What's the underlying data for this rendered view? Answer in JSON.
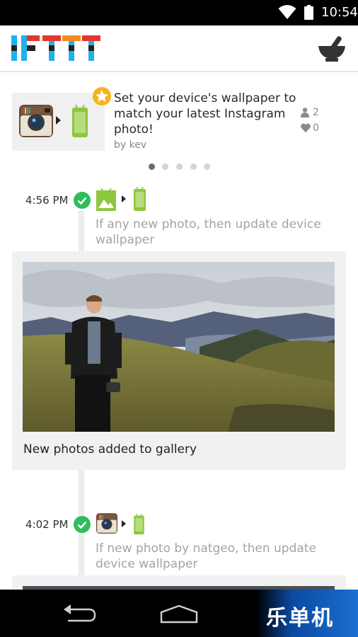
{
  "status_bar": {
    "time": "10:54",
    "icons": [
      "wifi-icon",
      "battery-icon"
    ]
  },
  "app_bar": {
    "logo_text": "IFTTT",
    "logo_colors": [
      "#1eb2e8",
      "#e5352d",
      "#222222",
      "#f58c1f"
    ],
    "right_icon": "mortar-pestle-icon"
  },
  "recipe": {
    "title": "Set your device's wallpaper to match your latest Instagram photo!",
    "author": "by kev",
    "users_count": "2",
    "likes_count": "0",
    "trigger_icon": "instagram-icon",
    "action_icon": "android-device-icon",
    "badge_icon": "star-badge-icon",
    "pager": {
      "total": 5,
      "active": 0
    }
  },
  "feed": [
    {
      "time": "4:56 PM",
      "status_icon": "success-check-icon",
      "trigger_icon": "android-photos-icon",
      "action_icon": "android-device-icon",
      "description": "If any new photo, then update device wallpaper",
      "caption": "New photos added to gallery"
    },
    {
      "time": "4:02 PM",
      "status_icon": "success-check-icon",
      "trigger_icon": "instagram-icon",
      "action_icon": "android-device-icon",
      "description": "If new photo by natgeo, then update device wallpaper"
    }
  ],
  "nav_bar": {
    "back_icon": "back-icon",
    "home_icon": "home-icon",
    "watermark": "乐单机"
  },
  "colors": {
    "check_green": "#2ebd59",
    "android_green": "#8ec63f",
    "star_gold": "#f7b21b"
  }
}
